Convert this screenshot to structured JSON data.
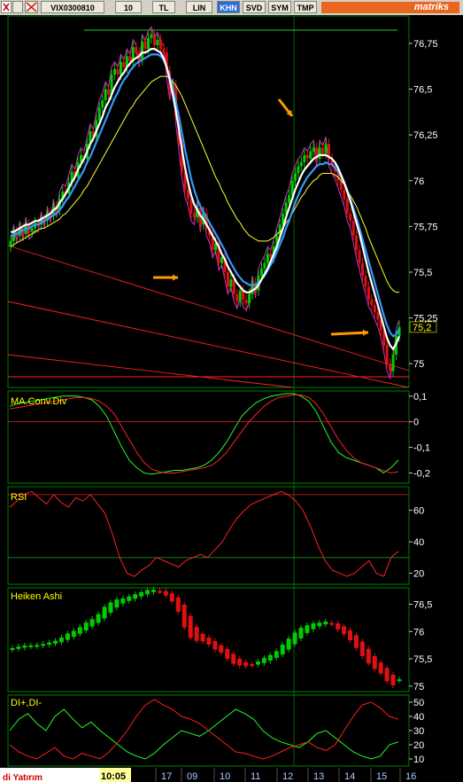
{
  "toolbar": {
    "symbol": "VIX0300810",
    "interval": "10",
    "buttons": [
      "TL",
      "LIN",
      "KHN",
      "SVD",
      "SYM",
      "TMP"
    ],
    "active_button": "KHN",
    "brand": "matriks"
  },
  "colors": {
    "background": "#000000",
    "axis": "#008000",
    "candle_up": "#00cc00",
    "candle_down": "#e01010",
    "ma_fast": "#ffffff",
    "ma_mid": "#3399ff",
    "ma_slow": "#ffff33",
    "envelope": "#cc33cc",
    "trendline": "#ff2020",
    "annotation_arrow": "#ff9900",
    "indicator_green": "#22ff22",
    "indicator_red": "#ff2020"
  },
  "footer": {
    "time": "10:05",
    "left_text": "di Yatırım",
    "x_ticks": [
      "17",
      "09",
      "10",
      "11",
      "12",
      "13",
      "14",
      "15",
      "16"
    ]
  },
  "chart_data": [
    {
      "type": "candlestick",
      "panel": "price",
      "y_ticks": [
        "76,75",
        "76,5",
        "76,25",
        "76",
        "75,75",
        "75,5",
        "75,25",
        "75"
      ],
      "ylim": [
        74.87,
        76.9
      ],
      "current_value_label": "75,2",
      "close": [
        75.67,
        75.72,
        75.7,
        75.74,
        75.71,
        75.76,
        75.72,
        75.74,
        75.77,
        75.76,
        75.79,
        75.78,
        75.82,
        75.81,
        75.86,
        75.84,
        75.9,
        75.94,
        75.93,
        75.99,
        76.05,
        76.02,
        76.1,
        76.14,
        76.12,
        76.2,
        76.27,
        76.24,
        76.33,
        76.4,
        76.44,
        76.5,
        76.47,
        76.58,
        76.61,
        76.58,
        76.65,
        76.62,
        76.68,
        76.65,
        76.73,
        76.7,
        76.66,
        76.76,
        76.72,
        76.78,
        76.8,
        76.74,
        76.77,
        76.72,
        76.7,
        76.6,
        76.48,
        76.52,
        76.35,
        76.2,
        76.05,
        75.95,
        75.9,
        75.82,
        75.8,
        75.85,
        75.76,
        75.82,
        75.74,
        75.7,
        75.62,
        75.66,
        75.55,
        75.58,
        75.5,
        75.42,
        75.46,
        75.38,
        75.34,
        75.4,
        75.35,
        75.33,
        75.38,
        75.44,
        75.4,
        75.48,
        75.52,
        75.55,
        75.6,
        75.58,
        75.64,
        75.7,
        75.76,
        75.82,
        75.88,
        75.92,
        76.0,
        76.04,
        76.08,
        76.1,
        76.14,
        76.12,
        76.16,
        76.18,
        76.12,
        76.18,
        76.15,
        76.2,
        76.12,
        76.08,
        76.05,
        76.0,
        75.95,
        75.9,
        75.82,
        75.78,
        75.7,
        75.62,
        75.55,
        75.48,
        75.42,
        75.35,
        75.32,
        75.28,
        75.24,
        75.18,
        75.1,
        75.0,
        74.96,
        75.05,
        75.15,
        75.2
      ],
      "moving_averages": [
        {
          "color": "ma_fast",
          "values": [
            75.72,
            75.72,
            75.73,
            75.74,
            75.75,
            75.76,
            75.76,
            75.77,
            75.78,
            75.78,
            75.79,
            75.8,
            75.81,
            75.82,
            75.84,
            75.85,
            75.88,
            75.9,
            75.93,
            75.96,
            75.99,
            76.02,
            76.06,
            76.09,
            76.12,
            76.16,
            76.2,
            76.23,
            76.27,
            76.31,
            76.35,
            76.4,
            76.43,
            76.47,
            76.51,
            76.54,
            76.57,
            76.59,
            76.62,
            76.64,
            76.66,
            76.67,
            76.68,
            76.7,
            76.7,
            76.71,
            76.72,
            76.72,
            76.71,
            76.7,
            76.67,
            76.62,
            76.55,
            76.47,
            76.38,
            76.28,
            76.17,
            76.07,
            75.99,
            75.92,
            75.87,
            75.84,
            75.81,
            75.79,
            75.76,
            75.73,
            75.7,
            75.67,
            75.64,
            75.6,
            75.57,
            75.53,
            75.5,
            75.47,
            75.44,
            75.42,
            75.4,
            75.39,
            75.39,
            75.4,
            75.41,
            75.43,
            75.46,
            75.49,
            75.52,
            75.56,
            75.6,
            75.64,
            75.69,
            75.74,
            75.8,
            75.85,
            75.9,
            75.95,
            75.99,
            76.03,
            76.06,
            76.08,
            76.1,
            76.12,
            76.13,
            76.14,
            76.14,
            76.14,
            76.13,
            76.12,
            76.1,
            76.07,
            76.03,
            75.99,
            75.94,
            75.89,
            75.83,
            75.77,
            75.71,
            75.64,
            75.57,
            75.5,
            75.44,
            75.38,
            75.32,
            75.26,
            75.2,
            75.14,
            75.1,
            75.08,
            75.11,
            75.15
          ]
        },
        {
          "color": "ma_mid",
          "values": [
            75.7,
            75.7,
            75.71,
            75.72,
            75.73,
            75.74,
            75.74,
            75.75,
            75.76,
            75.76,
            75.77,
            75.78,
            75.79,
            75.8,
            75.81,
            75.82,
            75.84,
            75.86,
            75.89,
            75.91,
            75.94,
            75.97,
            76.0,
            76.03,
            76.06,
            76.1,
            76.13,
            76.17,
            76.21,
            76.25,
            76.29,
            76.33,
            76.37,
            76.41,
            76.45,
            76.48,
            76.52,
            76.55,
            76.57,
            76.6,
            76.62,
            76.64,
            76.65,
            76.66,
            76.67,
            76.68,
            76.69,
            76.69,
            76.69,
            76.68,
            76.66,
            76.62,
            76.57,
            76.5,
            76.43,
            76.35,
            76.26,
            76.17,
            76.09,
            76.01,
            75.95,
            75.9,
            75.86,
            75.83,
            75.8,
            75.77,
            75.74,
            75.71,
            75.68,
            75.65,
            75.62,
            75.58,
            75.55,
            75.52,
            75.49,
            75.47,
            75.45,
            75.44,
            75.43,
            75.43,
            75.43,
            75.44,
            75.46,
            75.48,
            75.51,
            75.54,
            75.57,
            75.61,
            75.65,
            75.69,
            75.74,
            75.78,
            75.83,
            75.88,
            75.92,
            75.96,
            75.99,
            76.02,
            76.04,
            76.06,
            76.08,
            76.09,
            76.09,
            76.1,
            76.09,
            76.09,
            76.07,
            76.05,
            76.02,
            75.99,
            75.95,
            75.9,
            75.85,
            75.8,
            75.74,
            75.68,
            75.62,
            75.56,
            75.5,
            75.44,
            75.38,
            75.32,
            75.26,
            75.21,
            75.17,
            75.15,
            75.16,
            75.19
          ]
        },
        {
          "color": "ma_slow",
          "values": [
            75.64,
            75.65,
            75.66,
            75.67,
            75.68,
            75.69,
            75.7,
            75.71,
            75.72,
            75.73,
            75.74,
            75.74,
            75.75,
            75.76,
            75.77,
            75.78,
            75.79,
            75.81,
            75.82,
            75.84,
            75.86,
            75.88,
            75.9,
            75.92,
            75.95,
            75.97,
            76.0,
            76.03,
            76.06,
            76.09,
            76.12,
            76.15,
            76.18,
            76.21,
            76.24,
            76.27,
            76.3,
            76.33,
            76.36,
            76.39,
            76.41,
            76.44,
            76.46,
            76.48,
            76.5,
            76.52,
            76.54,
            76.55,
            76.56,
            76.57,
            76.57,
            76.57,
            76.56,
            76.54,
            76.52,
            76.49,
            76.46,
            76.42,
            76.38,
            76.34,
            76.3,
            76.26,
            76.22,
            76.18,
            76.14,
            76.1,
            76.06,
            76.02,
            75.99,
            75.95,
            75.92,
            75.88,
            75.85,
            75.82,
            75.79,
            75.77,
            75.74,
            75.72,
            75.7,
            75.69,
            75.68,
            75.67,
            75.67,
            75.67,
            75.67,
            75.68,
            75.69,
            75.71,
            75.72,
            75.74,
            75.77,
            75.79,
            75.82,
            75.85,
            75.88,
            75.91,
            75.93,
            75.96,
            75.98,
            76.0,
            76.01,
            76.03,
            76.04,
            76.04,
            76.04,
            76.04,
            76.03,
            76.02,
            76.0,
            75.98,
            75.95,
            75.92,
            75.89,
            75.86,
            75.82,
            75.78,
            75.74,
            75.69,
            75.65,
            75.61,
            75.57,
            75.53,
            75.49,
            75.45,
            75.42,
            75.4,
            75.39,
            75.39
          ]
        }
      ]
    },
    {
      "type": "line",
      "panel": "macd",
      "title": "MA.Conv.Div",
      "y_ticks": [
        "0,1",
        "0",
        "-0,1",
        "-0,2"
      ],
      "ylim": [
        -0.24,
        0.12
      ],
      "series": [
        {
          "color": "indicator_green",
          "values": [
            0.06,
            0.07,
            0.075,
            0.08,
            0.085,
            0.09,
            0.095,
            0.1,
            0.1,
            0.1,
            0.095,
            0.085,
            0.06,
            0.02,
            -0.04,
            -0.1,
            -0.15,
            -0.18,
            -0.2,
            -0.205,
            -0.2,
            -0.195,
            -0.19,
            -0.19,
            -0.185,
            -0.18,
            -0.17,
            -0.15,
            -0.12,
            -0.08,
            -0.03,
            0.02,
            0.05,
            0.075,
            0.09,
            0.1,
            0.105,
            0.11,
            0.11,
            0.1,
            0.08,
            0.04,
            -0.02,
            -0.08,
            -0.12,
            -0.14,
            -0.15,
            -0.16,
            -0.17,
            -0.18,
            -0.2,
            -0.18,
            -0.15
          ]
        },
        {
          "color": "indicator_red",
          "values": [
            0.05,
            0.055,
            0.06,
            0.065,
            0.07,
            0.075,
            0.08,
            0.085,
            0.09,
            0.095,
            0.095,
            0.09,
            0.08,
            0.06,
            0.03,
            -0.02,
            -0.07,
            -0.12,
            -0.16,
            -0.185,
            -0.195,
            -0.2,
            -0.2,
            -0.195,
            -0.19,
            -0.185,
            -0.18,
            -0.17,
            -0.15,
            -0.12,
            -0.08,
            -0.04,
            0.0,
            0.03,
            0.06,
            0.08,
            0.095,
            0.1,
            0.105,
            0.105,
            0.095,
            0.07,
            0.03,
            -0.02,
            -0.07,
            -0.11,
            -0.14,
            -0.16,
            -0.17,
            -0.18,
            -0.19,
            -0.2,
            -0.195
          ]
        }
      ]
    },
    {
      "type": "line",
      "panel": "rsi",
      "title": "RSI",
      "y_ticks": [
        "60",
        "40",
        "20"
      ],
      "ylim": [
        13,
        75
      ],
      "reference_lines": [
        30,
        70
      ],
      "series": [
        {
          "color": "indicator_red",
          "values": [
            62,
            66,
            70,
            72,
            68,
            64,
            70,
            65,
            62,
            68,
            66,
            70,
            64,
            58,
            45,
            30,
            20,
            18,
            22,
            25,
            30,
            28,
            26,
            24,
            28,
            30,
            32,
            30,
            35,
            40,
            48,
            55,
            60,
            64,
            66,
            68,
            70,
            72,
            70,
            66,
            60,
            50,
            38,
            28,
            22,
            20,
            18,
            20,
            24,
            28,
            20,
            18,
            30,
            34
          ]
        }
      ]
    },
    {
      "type": "candlestick",
      "panel": "heiken_ashi",
      "title": "Heiken Ashi",
      "y_ticks": [
        "76,5",
        "76",
        "75,5",
        "75"
      ],
      "ylim": [
        74.9,
        76.8
      ]
    },
    {
      "type": "line",
      "panel": "dmi",
      "title": "DI+,DI-",
      "y_ticks": [
        "50",
        "40",
        "30",
        "20",
        "10"
      ],
      "ylim": [
        5,
        55
      ],
      "series": [
        {
          "color": "indicator_green",
          "values": [
            30,
            38,
            42,
            35,
            30,
            40,
            45,
            38,
            32,
            36,
            30,
            25,
            20,
            15,
            12,
            10,
            14,
            20,
            25,
            30,
            28,
            26,
            30,
            35,
            40,
            45,
            42,
            38,
            30,
            25,
            22,
            20,
            18,
            22,
            28,
            30,
            25,
            20,
            15,
            12,
            10,
            12,
            20,
            22
          ]
        },
        {
          "color": "indicator_red",
          "values": [
            20,
            15,
            12,
            10,
            14,
            18,
            12,
            10,
            14,
            12,
            10,
            15,
            22,
            30,
            40,
            48,
            52,
            48,
            45,
            40,
            38,
            35,
            30,
            25,
            20,
            15,
            14,
            12,
            10,
            12,
            15,
            18,
            20,
            22,
            18,
            16,
            20,
            30,
            40,
            48,
            50,
            46,
            40,
            38
          ]
        }
      ]
    }
  ]
}
